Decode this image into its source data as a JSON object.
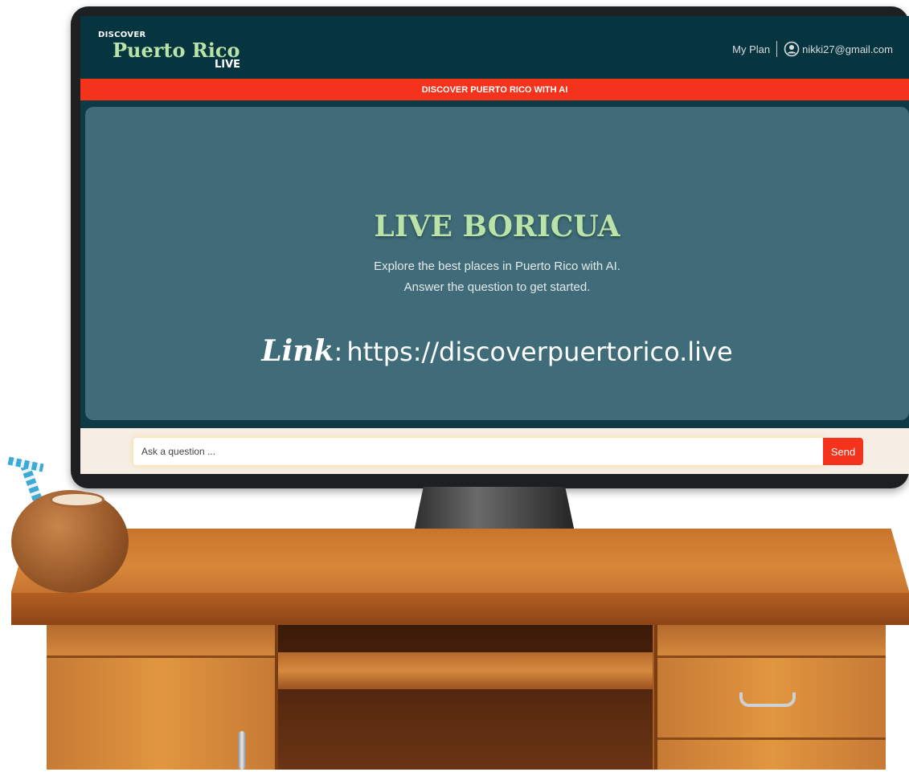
{
  "app": {
    "logo": {
      "top": "DISCOVER",
      "main": "Puerto Rico",
      "sub": "LIVE"
    },
    "header": {
      "my_plan": "My Plan",
      "user_email": "nikki27@gmail.com"
    },
    "banner": "DISCOVER PUERTO RICO WITH AI",
    "hero": {
      "title": "LIVE BORICUA",
      "subtitle_line1": "Explore the best places in Puerto Rico with AI.",
      "subtitle_line2": "Answer the question to get started.",
      "link_label": "Link",
      "link_colon": ":",
      "link_url": "https://discoverpuertorico.live"
    },
    "chat": {
      "placeholder": "Ask a question ...",
      "send_label": "Send"
    }
  },
  "colors": {
    "header_bg": "#06343f",
    "banner_red": "#f5321c",
    "hero_bg": "#3f6c78",
    "accent_green": "#b9e3a8",
    "chat_bg": "#f6eee5"
  },
  "icons": {
    "user": "user-circle-icon"
  }
}
